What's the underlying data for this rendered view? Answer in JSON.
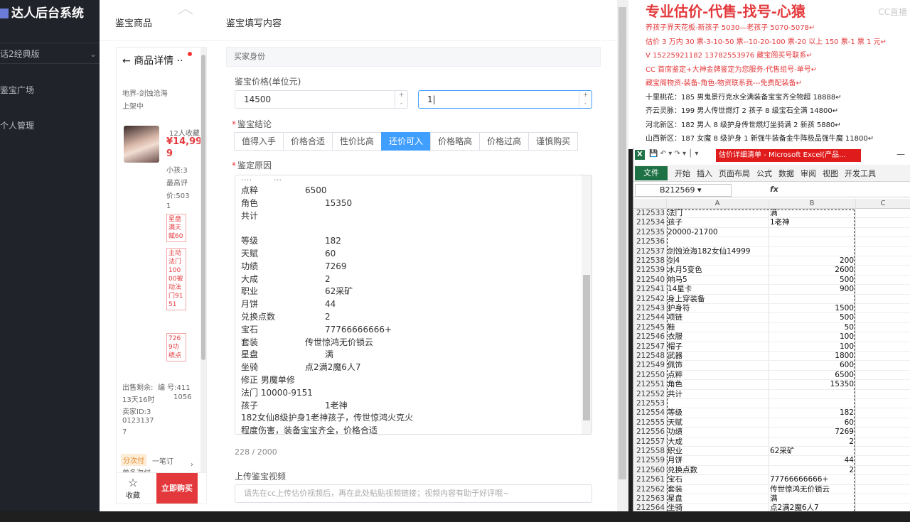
{
  "admin": {
    "title": "达人后台系统",
    "version": "话2经典版",
    "items": [
      "鉴宝广场",
      "个人管理"
    ]
  },
  "dialog": {
    "tab_left": "鉴宝商品",
    "tab_right": "鉴宝填写内容"
  },
  "phone": {
    "title": "商品详情",
    "back_icon": "arrow-left-icon",
    "server": "地界-剑蚀沧海",
    "status": "上架中",
    "collect": "12人收藏",
    "price": "¥14,999",
    "kid": "小孩:3",
    "best": "最高评",
    "price_eval": "价:503",
    "price_eval2": "1",
    "tags": [
      "星盘满天赋60",
      "主动法门10000被动法门9151",
      "7269功绩点"
    ],
    "sale_left": "出售剩余:",
    "sale_time": "13天16时",
    "seller": "卖家ID:3",
    "seller2": "0123137",
    "seller3": "7",
    "num_label": "编 号:411",
    "num_value": "1056",
    "split_tag": "分次付",
    "split_text": "一笔订",
    "more": "单多次付",
    "fav": "收藏",
    "buy": "立即购买"
  },
  "form": {
    "section": "买家身份",
    "price_label": "鉴宝价格(单位元)",
    "price_min": "14500",
    "price_max": "1",
    "conclusion_label": "鉴宝结论",
    "options": [
      "值得入手",
      "价格合适",
      "性价比高",
      "还价可入",
      "价格略高",
      "价格过高",
      "谨慎购买"
    ],
    "selected": "还价可入",
    "reason_label": "鉴定原因",
    "lines": [
      [
        "点粹",
        "6500",
        90
      ],
      [
        "角色",
        "15350",
        118
      ],
      [
        "共计",
        "",
        0
      ],
      [
        "",
        "",
        0
      ],
      [
        "等级",
        "182",
        118
      ],
      [
        "天赋",
        "60",
        118
      ],
      [
        "功绩",
        "7269",
        118
      ],
      [
        "大成",
        "2",
        118
      ],
      [
        "职业",
        "62采矿",
        118
      ],
      [
        "月饼",
        "44",
        118
      ],
      [
        "兑换点数",
        "2",
        118
      ],
      [
        "宝石",
        "77766666666+",
        118
      ],
      [
        "套装",
        "传世惊鸿无价锁云",
        90
      ],
      [
        "星盘",
        "满",
        118
      ],
      [
        "坐骑",
        "点2满2魔6人7",
        90
      ],
      [
        "修正 男魔单修",
        "",
        0
      ],
      [
        "法门 10000-9151",
        "",
        0
      ],
      [
        "孩子",
        "1老神",
        118
      ],
      [
        "182女仙8级护身1老神孩子，传世惊鸿火克火",
        "",
        0
      ],
      [
        "程度伤害，装备宝宝齐全，价格合适",
        "",
        0
      ]
    ],
    "counter": "228 / 2000",
    "video_label": "上传鉴宝视频",
    "video_placeholder": "请先在cc上传估价视频后，再在此处粘贴视频链接；视频内容有助于好评哦~"
  },
  "notes": {
    "headline": "专业估价-代售-找号-心猿",
    "watermark": "CC直播",
    "lines": [
      {
        "t": "养孩子界天花板-新孩子 5030—老孩子 5070-5078",
        "c": "red"
      },
      {
        "t": "估价 3 万内 30 票-3-10-50 票--10-20-100 票-20 以上 150 票-1 票 1 元",
        "c": "red"
      },
      {
        "t": "V 15225921182      13782553976    藏宝阁买号联系",
        "c": "red"
      },
      {
        "t": "CC 首席鉴定+大神金牌鉴定为您服务-代售组号-单号",
        "c": "red"
      },
      {
        "t": "藏宝阁物资-装备-角色-物资联系我---免费配装备",
        "c": "red"
      },
      {
        "t": "十里桃花：185 男鬼景行克水全满装备宝宝齐全物超 18888",
        "c": "blk"
      },
      {
        "t": "齐云灵脉：199 男人传世燃灯 2 孩子 8 级宝石全满 14800",
        "c": "blk"
      },
      {
        "t": "河北新区：182 男人 8 级护身传世燃灯坐骑满 2 新孩 5880",
        "c": "blk"
      },
      {
        "t": "山西新区：187 女魔 8 级护身 1 新强牛装备金牛阵极品强牛魔 11800",
        "c": "blk"
      }
    ]
  },
  "excel": {
    "title": "估价详细清单 - Microsoft Excel(产品...",
    "file_tab": "文件",
    "tabs": [
      "开始",
      "插入",
      "页面布局",
      "公式",
      "数据",
      "审阅",
      "视图",
      "开发工具"
    ],
    "namebox": "B212569",
    "fx": "fx",
    "cols": [
      "A",
      "B",
      "C"
    ],
    "rows": [
      [
        "212533",
        "法门",
        "满",
        "l"
      ],
      [
        "212534",
        "孩子",
        "1老神",
        "l"
      ],
      [
        "212535",
        "20000-21700",
        "",
        "l"
      ],
      [
        "212536",
        "",
        "",
        "l"
      ],
      [
        "212537",
        "剑蚀沧海182女仙14999",
        "",
        "l"
      ],
      [
        "212538",
        "剑4",
        "200",
        "r"
      ],
      [
        "212539",
        "水月5变色",
        "2600",
        "r"
      ],
      [
        "212540",
        "响马5",
        "500",
        "r"
      ],
      [
        "212541",
        "14星卡",
        "900",
        "r"
      ],
      [
        "212542",
        "身上穿装备",
        "",
        "l"
      ],
      [
        "212543",
        "护身符",
        "1500",
        "r"
      ],
      [
        "212544",
        "项链",
        "500",
        "r"
      ],
      [
        "212545",
        "鞋",
        "50",
        "r"
      ],
      [
        "212546",
        "衣服",
        "100",
        "r"
      ],
      [
        "212547",
        "帽子",
        "100",
        "r"
      ],
      [
        "212548",
        "武器",
        "1800",
        "r"
      ],
      [
        "212549",
        "佩饰",
        "600",
        "r"
      ],
      [
        "212550",
        "点粹",
        "6500",
        "r"
      ],
      [
        "212551",
        "角色",
        "15350",
        "r"
      ],
      [
        "212552",
        "共计",
        "",
        "l"
      ],
      [
        "212553",
        "",
        "",
        "l"
      ],
      [
        "212554",
        "等级",
        "182",
        "r"
      ],
      [
        "212555",
        "天赋",
        "60",
        "r"
      ],
      [
        "212556",
        "功绩",
        "7269",
        "r"
      ],
      [
        "212557",
        "大成",
        "2",
        "r"
      ],
      [
        "212558",
        "职业",
        "62采矿",
        "l"
      ],
      [
        "212559",
        "月饼",
        "44",
        "r"
      ],
      [
        "212560",
        "兑换点数",
        "2",
        "r"
      ],
      [
        "212561",
        "宝石",
        "77766666666+",
        "l"
      ],
      [
        "212562",
        "套装",
        "传世惊鸿无价锁云",
        "l"
      ],
      [
        "212563",
        "星盘",
        "满",
        "l"
      ],
      [
        "212564",
        "坐骑",
        "点2满2魔6人7",
        "l"
      ]
    ]
  }
}
